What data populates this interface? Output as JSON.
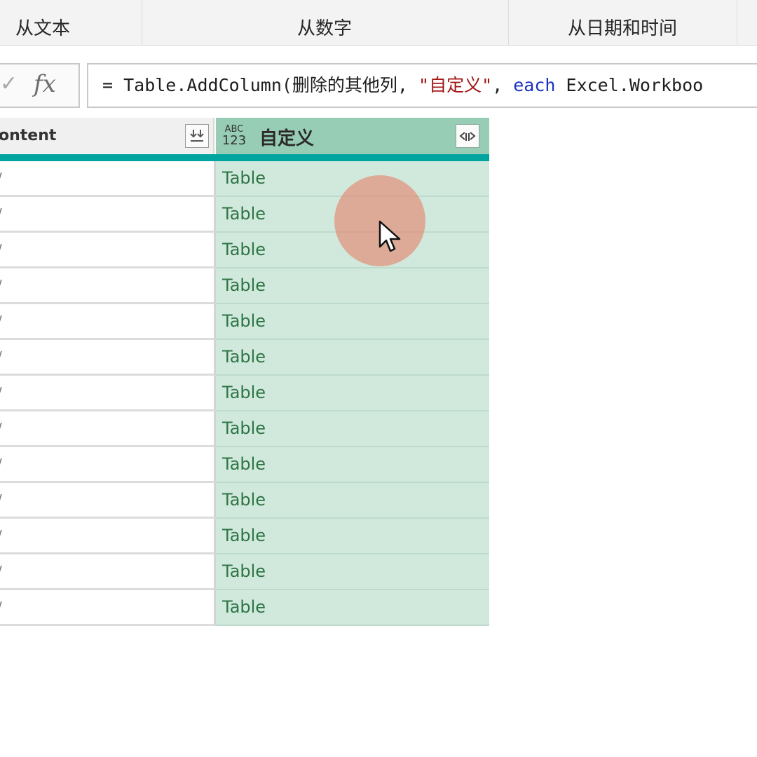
{
  "ribbon": {
    "groups": [
      {
        "label": "从文本"
      },
      {
        "label": "从数字"
      },
      {
        "label": "从日期和时间"
      }
    ]
  },
  "formula_bar": {
    "check_glyph": "✓",
    "fx_label": "fx",
    "formula_prefix": "= Table.AddColumn(删除的其他列, ",
    "formula_string": "\"自定义\"",
    "formula_separator": ", ",
    "formula_keyword": "each",
    "formula_suffix": " Excel.Workboo"
  },
  "grid": {
    "columns": [
      {
        "label": "ontent",
        "action_icon": "expand-down-icon"
      },
      {
        "type_icon_top": "ABC",
        "type_icon_bottom": "123",
        "label": "自定义",
        "action_icon": "expand-columns-icon"
      }
    ],
    "row_values": [
      "Table",
      "Table",
      "Table",
      "Table",
      "Table",
      "Table",
      "Table",
      "Table",
      "Table",
      "Table",
      "Table",
      "Table",
      "Table"
    ],
    "colors": {
      "selected_header": "#97cdb4",
      "selected_cell": "#d1e9dd",
      "table_text": "#2e7545",
      "accent": "#00a5a0"
    }
  }
}
